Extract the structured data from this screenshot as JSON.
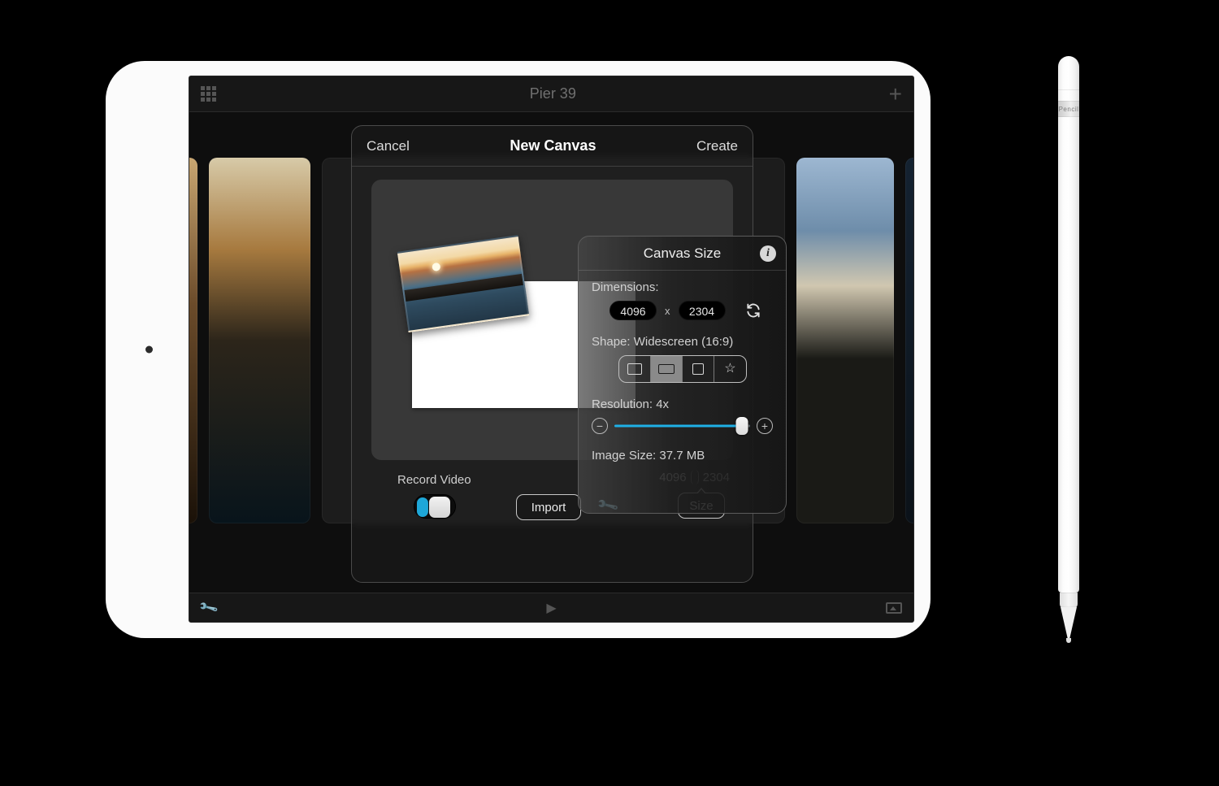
{
  "topbar": {
    "title": "Pier 39"
  },
  "modal": {
    "cancel": "Cancel",
    "title": "New Canvas",
    "create": "Create",
    "record_label": "Record Video",
    "import_label": "Import",
    "dim_w": "4096",
    "dim_h": "2304",
    "size_label": "Size"
  },
  "popover": {
    "title": "Canvas Size",
    "dimensions_label": "Dimensions:",
    "width": "4096",
    "x": "x",
    "height": "2304",
    "shape_label": "Shape: Widescreen (16:9)",
    "resolution_label": "Resolution: 4x",
    "image_size_label": "Image Size: 37.7 MB"
  },
  "pencil": {
    "band_text": "Pencil"
  }
}
